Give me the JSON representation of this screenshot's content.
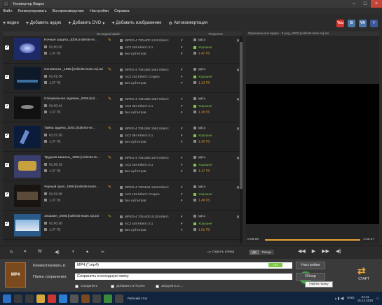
{
  "window": {
    "title": "Конвертер Видео"
  },
  "menu": [
    "Файл",
    "Конвертировать",
    "Воспроизведение",
    "Настройки",
    "Справка"
  ],
  "toolbar": {
    "add_video": "видео",
    "add_audio": "Добавить аудио",
    "add_dvd": "Добавить DVD",
    "add_image": "Добавить изображение",
    "autoconvert": "Автоконвертация"
  },
  "social": [
    {
      "name": "youtube",
      "label": "You",
      "color": "#d9342b"
    },
    {
      "name": "vk",
      "label": "B",
      "color": "#4a76a8"
    },
    {
      "name": "vk2",
      "label": "VK",
      "color": "#4a76a8"
    },
    {
      "name": "facebook",
      "label": "f",
      "color": "#3b5998"
    }
  ],
  "list_headers": {
    "source": "Исходный файл",
    "result": "Результат"
  },
  "files": [
    {
      "name": "Ночная защита_2006.[nolimits-te...",
      "duration": "01:50:20",
      "size": "1.37 ГБ",
      "video": "MPEG-4 720x400 1315 Кбит/с",
      "audio": "AC3 448 Кбит/с 5.1",
      "subs": "Без субтитров",
      "out_fmt": "MP4",
      "out_quality": "Хорошее",
      "out_size": "1.47 ГБ",
      "thumb_color": "#1d2a66"
    },
    {
      "name": "Сеновосха _1996.[nolimits-team.ru].avi",
      "duration": "01:41:36",
      "size": "1.37 ГБ",
      "video": "MPEG-4 704x368 1561 Кбит/с",
      "audio": "AC3 192 Кбит/с Стерео",
      "subs": "Без субтитров",
      "out_fmt": "MP4",
      "out_quality": "Хорошее",
      "out_size": "1.13 ГБ",
      "thumb_color": "#0e1a2a"
    },
    {
      "name": "Специальное задание_2006.[nol...",
      "duration": "01:30:41",
      "size": "1.37 ГБ",
      "video": "MPEG-4 704x368 1597 Кбит/с",
      "audio": "AC3 384 Кбит/с 5.1",
      "subs": "Без субтитров",
      "out_fmt": "MP4",
      "out_quality": "Хорошее",
      "out_size": "1.18 ГБ",
      "thumb_color": "#111111"
    },
    {
      "name": "Тайна ордена_2001.[nolimits-te...",
      "duration": "01:37:26",
      "size": "1.37 ГБ",
      "video": "MPEG-4 704x384 1591 Кбит/с",
      "audio": "AC3 384 Кбит/с 5.1",
      "subs": "Без субтитров",
      "out_fmt": "MP4",
      "out_quality": "Хорошее",
      "out_size": "1.30 ГБ",
      "thumb_color": "#0b1c3a"
    },
    {
      "name": "Трудная мишень_1993.[nolimits-te...",
      "duration": "01:38:15",
      "size": "1.37 ГБ",
      "video": "MPEG-4 704x368 1670 Кбит/с",
      "audio": "AC3 448 Кбит/с 5.1",
      "subs": "Без субтитров",
      "out_fmt": "MP4",
      "out_quality": "Хорошее",
      "out_size": "1.17 ГБ",
      "thumb_color": "#3a3f6e"
    },
    {
      "name": "Черный орел_1988.[nolimits-team...",
      "duration": "01:32:28",
      "size": "1.37 ГБ",
      "video": "MPEG-4 720x544 1638 Кбит/с",
      "audio": "AC3 192 Кбит/с Стерео",
      "subs": "Без субтитров",
      "out_fmt": "MP4",
      "out_quality": "Хорошее",
      "out_size": "1.48 ГБ",
      "thumb_color": "#1a1410"
    },
    {
      "name": "Экзамен_2006.[nolimits-team.ru].avi",
      "duration": "01:00:28",
      "size": "1.37 ГБ",
      "video": "MPEG-4 704x400 2135 Кбит/с",
      "audio": "AC3 448 Кбит/с 5.1",
      "subs": "Без субтитров",
      "out_fmt": "MP4",
      "out_quality": "Хорошее",
      "out_size": "1.61 ГБ",
      "thumb_color": "#2a5a8a"
    }
  ],
  "preview": {
    "title": "Оригинальное видео - 8 ущу_2003.[nolimits-team.ru].avi",
    "time_start": "0:00:00",
    "time_end": "1:32:17"
  },
  "controls": {
    "merge": "Скрыть плеер",
    "on": "Да",
    "off": "Плеер"
  },
  "convert": {
    "label": "Конвертировать в:",
    "format": "MP4 (*.mp4)",
    "badge": "HD",
    "settings": "Настройки",
    "save_label": "Папка сохранения:",
    "save_value": "Сохранить в исходную папку",
    "browse": "Обзор",
    "tooltip": "Найти папку",
    "cb_merge": "Соединить",
    "cb_library": "Добавить в iTunes",
    "cb_upload": "Загрузить в ...",
    "start": "СТАРТ",
    "icon_label": "MP4"
  },
  "taskbar": {
    "desktop": "Рабочий стол",
    "lang": "ENG",
    "time": "21:11",
    "date": "15.12.2016"
  }
}
